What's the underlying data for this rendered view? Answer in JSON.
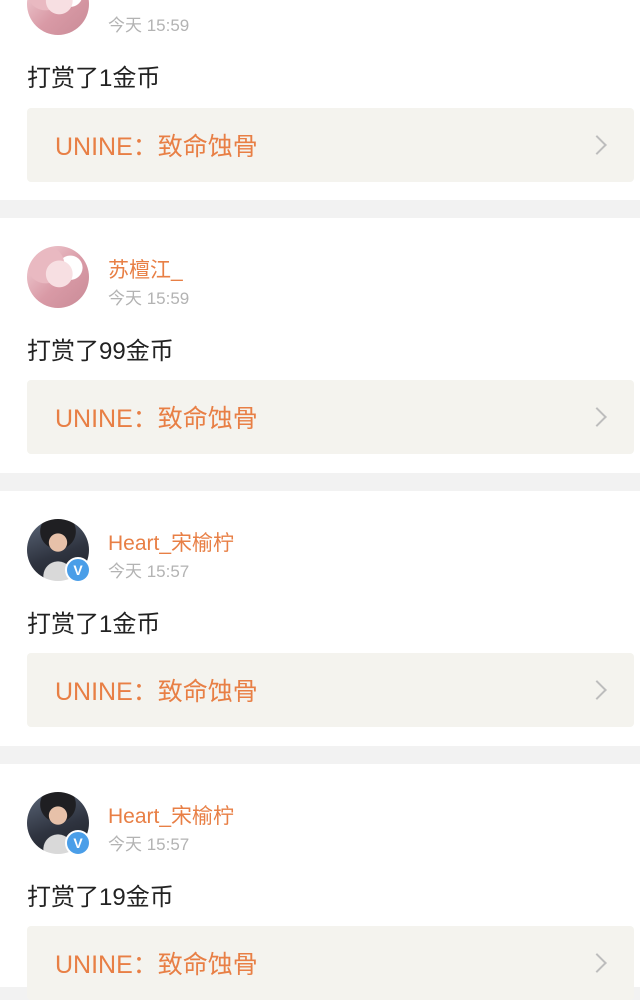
{
  "colors": {
    "accent": "#e87f45",
    "timestamp": "#b3b3b3",
    "link_bg": "#f4f3ee",
    "verified": "#4a9ee8"
  },
  "posts": [
    {
      "username": "",
      "timestamp": "今天 15:59",
      "message": "打赏了1金币",
      "link": "UNINE：致命蚀骨",
      "avatar": "pink",
      "verified": false
    },
    {
      "username": "苏檀江_",
      "timestamp": "今天 15:59",
      "message": "打赏了99金币",
      "link": "UNINE：致命蚀骨",
      "avatar": "pink",
      "verified": false
    },
    {
      "username": "Heart_宋榆柠",
      "timestamp": "今天 15:57",
      "message": "打赏了1金币",
      "link": "UNINE：致命蚀骨",
      "avatar": "dark",
      "verified": true,
      "badge": "V"
    },
    {
      "username": "Heart_宋榆柠",
      "timestamp": "今天 15:57",
      "message": "打赏了19金币",
      "link": "UNINE：致命蚀骨",
      "avatar": "dark",
      "verified": true,
      "badge": "V"
    }
  ]
}
